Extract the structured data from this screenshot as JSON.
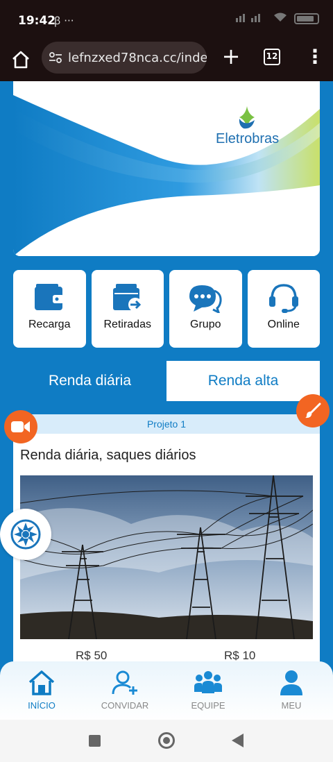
{
  "status_bar": {
    "time": "19:42",
    "extra": "ꞵ ···"
  },
  "browser": {
    "url": "lefnzxed78nca.cc/inde",
    "tab_count": "12"
  },
  "banner": {
    "brand": "Eletrobras"
  },
  "actions": [
    {
      "label": "Recarga",
      "icon": "wallet-icon"
    },
    {
      "label": "Retiradas",
      "icon": "withdraw-icon"
    },
    {
      "label": "Grupo",
      "icon": "chat-icon"
    },
    {
      "label": "Online",
      "icon": "headset-icon"
    }
  ],
  "tabs": [
    {
      "label": "Renda diária",
      "active": true
    },
    {
      "label": "Renda alta",
      "active": false
    }
  ],
  "project": {
    "header": "Projeto 1",
    "title": "Renda diária, saques diários",
    "price_left": "R$ 50",
    "price_right": "R$ 10"
  },
  "bottom_nav": [
    {
      "label": "INÍCIO",
      "icon": "home-icon",
      "active": true
    },
    {
      "label": "CONVIDAR",
      "icon": "add-user-icon",
      "active": false
    },
    {
      "label": "EQUIPE",
      "icon": "team-icon",
      "active": false
    },
    {
      "label": "MEU",
      "icon": "user-icon",
      "active": false
    }
  ],
  "colors": {
    "primary": "#0f7cc4",
    "accent": "#f26522",
    "header_bg": "#1c1010"
  }
}
